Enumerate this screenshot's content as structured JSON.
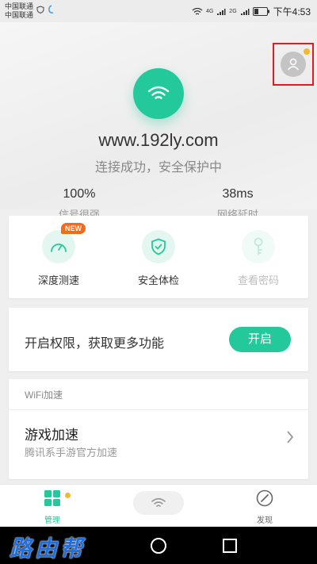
{
  "status_bar": {
    "carrier1": "中国联通",
    "carrier2": "中国联通",
    "network_4g": "4G",
    "network_2g": "2G",
    "time": "下午4:53"
  },
  "header": {
    "ssid": "www.192ly.com",
    "status": "连接成功，安全保护中",
    "has_notification": true
  },
  "metrics": {
    "signal_value": "100%",
    "signal_label": "信号很强",
    "latency_value": "38ms",
    "latency_label": "网络延时"
  },
  "tools": {
    "speed_label": "深度测速",
    "speed_badge": "NEW",
    "security_label": "安全体检",
    "password_label": "查看密码"
  },
  "permission": {
    "text": "开启权限，获取更多功能",
    "button": "开启"
  },
  "accel": {
    "header": "WiFi加速",
    "title": "游戏加速",
    "subtitle": "腾讯系手游官方加速"
  },
  "tabbar": {
    "manage": "管理",
    "discover": "发现"
  },
  "watermark": "路由帮",
  "colors": {
    "accent": "#23c99a",
    "badge": "#f26b1d",
    "dot": "#f5b72b"
  }
}
